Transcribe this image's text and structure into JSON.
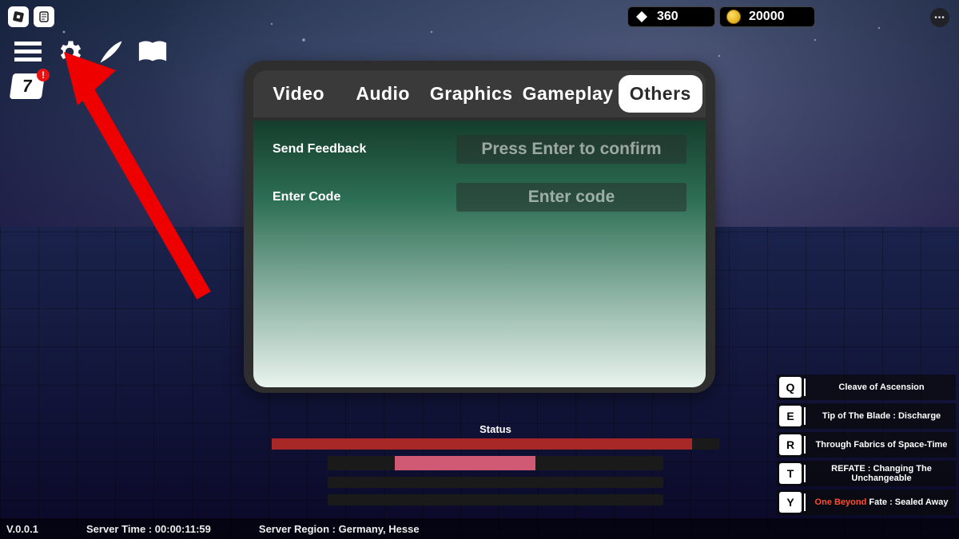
{
  "roblox_icons": {
    "logo": "◆",
    "dev": "🗒"
  },
  "topLeft": {
    "calendar_day": "7",
    "calendar_badge": "!"
  },
  "currency": {
    "gems": "360",
    "gold": "20000"
  },
  "settings": {
    "tabs": [
      "Video",
      "Audio",
      "Graphics",
      "Gameplay",
      "Others"
    ],
    "active_index": 4,
    "rows": {
      "feedback_label": "Send Feedback",
      "feedback_placeholder": "Press Enter to confirm",
      "code_label": "Enter Code",
      "code_placeholder": "Enter code"
    }
  },
  "hud": {
    "status_label": "Status"
  },
  "abilities": [
    {
      "key": "Q",
      "label": "Cleave of Ascension"
    },
    {
      "key": "E",
      "label": "Tip of The Blade : Discharge"
    },
    {
      "key": "R",
      "label": "Through Fabrics of Space-Time"
    },
    {
      "key": "T",
      "label": "REFATE : Changing The Unchangeable"
    },
    {
      "key": "Y",
      "accent": "One Beyond",
      "label": " Fate : Sealed Away"
    }
  ],
  "footer": {
    "version": "V.0.0.1",
    "server_time_label": "Server Time :",
    "server_time": "00:00:11:59",
    "server_region_label": "Server Region :",
    "server_region": "Germany, Hesse"
  }
}
